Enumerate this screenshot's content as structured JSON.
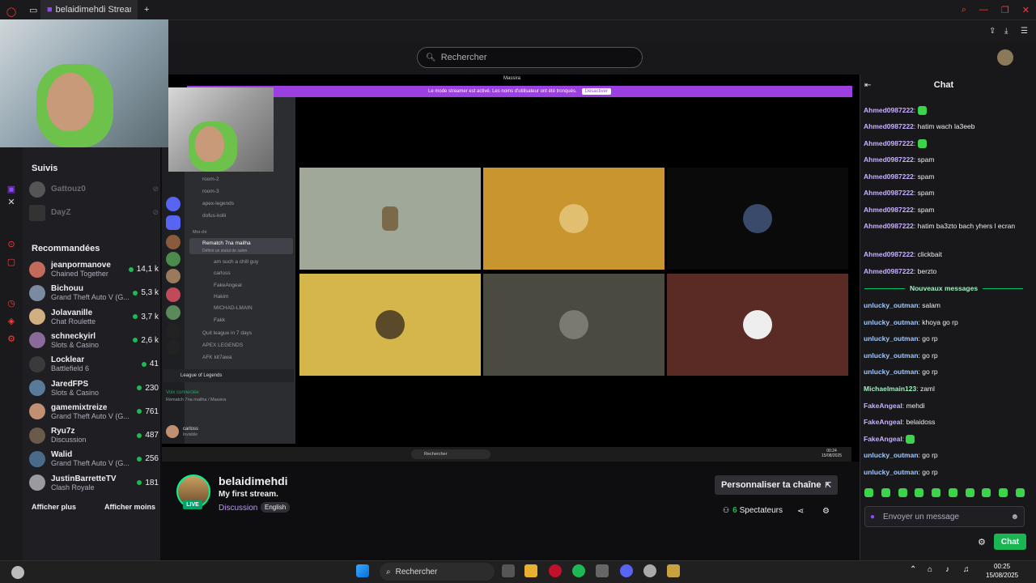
{
  "browser": {
    "tab_title": "belaidimehdi Stream - Wa",
    "new_tab": "+"
  },
  "twitch": {
    "search_placeholder": "Rechercher",
    "followed_title": "Suivis",
    "followed": [
      {
        "name": "Gattouz0"
      },
      {
        "name": "DayZ"
      }
    ],
    "recommended_title": "Recommandées",
    "recommended": [
      {
        "name": "jeanpormanove",
        "game": "Chained Together",
        "viewers": "14,1 k",
        "color": "#c46a5a"
      },
      {
        "name": "Bichouu",
        "game": "Grand Theft Auto V (G...",
        "viewers": "5,3 k",
        "color": "#7a8aa0"
      },
      {
        "name": "Jolavanille",
        "game": "Chat Roulette",
        "viewers": "3,7 k",
        "color": "#d0b080"
      },
      {
        "name": "schneckyirl",
        "game": "Slots & Casino",
        "viewers": "2,6 k",
        "color": "#8a6a9a"
      },
      {
        "name": "Locklear",
        "game": "Battlefield 6",
        "viewers": "41",
        "color": "#3a3a3a"
      },
      {
        "name": "JaredFPS",
        "game": "Slots & Casino",
        "viewers": "230",
        "color": "#5a7a9a"
      },
      {
        "name": "gamemixtreize",
        "game": "Grand Theft Auto V (G...",
        "viewers": "761",
        "color": "#c09070"
      },
      {
        "name": "Ryu7z",
        "game": "Discussion",
        "viewers": "487",
        "color": "#6a5a4a"
      },
      {
        "name": "Walid",
        "game": "Grand Theft Auto V (G...",
        "viewers": "256",
        "color": "#4a6a8a"
      },
      {
        "name": "JustinBarretteTV",
        "game": "Clash Royale",
        "viewers": "181",
        "color": "#9a9aa0"
      }
    ],
    "show_more": "Afficher plus",
    "show_less": "Afficher moins"
  },
  "discord": {
    "banner_text": "Le mode streamer est activé. Les noms d'utilisateur ont été tronqués.",
    "banner_button": "Désactiver",
    "window_title": "Massira",
    "channels": [
      "room-2",
      "room-3",
      "apex-legends",
      "dofus-kolii"
    ],
    "category": "Moi chi",
    "voice_channel": "Rematch 7na mailha",
    "voice_subtitle": "Définir un statut de salon",
    "voice_members": [
      "am such a chill guy",
      "carloss",
      "FakeAngeal",
      "Hakim",
      "MICHAD-LMAIN",
      "Fakk"
    ],
    "other_channels": [
      "Quit league in 7 days",
      "APEX LEGENDS",
      "AFK kit7awa"
    ],
    "activity": "League of Legends",
    "voice_connected": "Voix connectée",
    "voice_connected_sub": "Rematch 7na mailha / Massira",
    "user_name": "carloss",
    "user_status": "Invisible",
    "inner_search": "Rechercher",
    "inner_clock_time": "00:24",
    "inner_clock_date": "15/08/2025"
  },
  "stream": {
    "name": "belaidimehdi",
    "title": "My first stream.",
    "category": "Discussion",
    "language": "English",
    "live": "LIVE",
    "customize": "Personnaliser ta chaîne",
    "viewer_count": "6",
    "viewer_label": "Spectateurs"
  },
  "chat": {
    "title": "Chat",
    "messages_before": [
      {
        "user": "Ahmed0987222",
        "text": "",
        "emote": true
      },
      {
        "user": "Ahmed0987222",
        "text": "hatim wach la3eeb",
        "emote": false
      },
      {
        "user": "Ahmed0987222",
        "text": "",
        "emote": true
      },
      {
        "user": "Ahmed0987222",
        "text": "spam",
        "emote": false
      },
      {
        "user": "Ahmed0987222",
        "text": "spam",
        "emote": false
      },
      {
        "user": "Ahmed0987222",
        "text": "spam",
        "emote": false
      },
      {
        "user": "Ahmed0987222",
        "text": "spam",
        "emote": false
      },
      {
        "user": "Ahmed0987222",
        "text": "hatim ba3zto bach yhers l ecran",
        "emote": false
      },
      {
        "user": "Ahmed0987222",
        "text": "clickbait",
        "emote": false
      },
      {
        "user": "Ahmed0987222",
        "text": "berzto",
        "emote": false
      }
    ],
    "new_messages_label": "Nouveaux messages",
    "messages_after": [
      {
        "user": "unlucky_outman",
        "text": "salam",
        "color": "#a0c8ff",
        "emote": false
      },
      {
        "user": "unlucky_outman",
        "text": "khoya go rp",
        "color": "#a0c8ff",
        "emote": false
      },
      {
        "user": "unlucky_outman",
        "text": "go rp",
        "color": "#a0c8ff",
        "emote": false
      },
      {
        "user": "unlucky_outman",
        "text": "go rp",
        "color": "#a0c8ff",
        "emote": false
      },
      {
        "user": "unlucky_outman",
        "text": "go rp",
        "color": "#a0c8ff",
        "emote": false
      },
      {
        "user": "Michaelmain123",
        "text": "zaml",
        "color": "#9df2c0",
        "emote": false
      },
      {
        "user": "FakeAngeal",
        "text": "mehdi",
        "color": "#c8b0ff",
        "emote": false
      },
      {
        "user": "FakeAngeal",
        "text": "belaidoss",
        "color": "#c8b0ff",
        "emote": false
      },
      {
        "user": "FakeAngeal",
        "text": "",
        "color": "#c8b0ff",
        "emote": true
      },
      {
        "user": "unlucky_outman",
        "text": "go rp",
        "color": "#a0c8ff",
        "emote": false
      },
      {
        "user": "unlucky_outman",
        "text": "go rp",
        "color": "#a0c8ff",
        "emote": false
      }
    ],
    "input_placeholder": "Envoyer un message",
    "send_button": "Chat"
  },
  "taskbar": {
    "search": "Rechercher",
    "time": "00:25",
    "date": "15/08/2025"
  },
  "colors": {
    "twitch_purple": "#9146ff",
    "live_green": "#00f593",
    "chat_send": "#1bb654"
  }
}
